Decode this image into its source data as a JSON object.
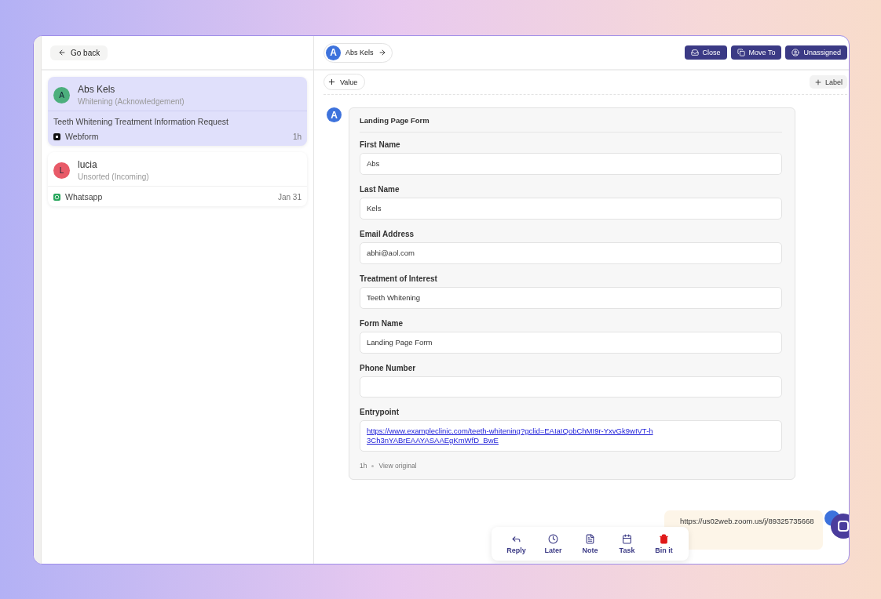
{
  "sidebar": {
    "back_button": "Go back",
    "conversations": [
      {
        "initial": "A",
        "name": "Abs Kels",
        "subtitle": "Whitening (Acknowledgement)",
        "subject": "Teeth Whitening Treatment Information Request",
        "channel": "Webform",
        "kind": "webform",
        "time": "1h",
        "selected": true,
        "color": "#4caf7d"
      },
      {
        "initial": "L",
        "name": "lucia",
        "subtitle": "Unsorted (Incoming)",
        "channel": "Whatsapp",
        "kind": "whatsapp",
        "time": "Jan 31",
        "selected": false,
        "color": "#e85a68"
      }
    ]
  },
  "header": {
    "contact_initial": "A",
    "contact_name": "Abs Kels",
    "buttons": [
      {
        "label": "Close",
        "kind": "close"
      },
      {
        "label": "Move To",
        "kind": "move"
      },
      {
        "label": "Unassigned",
        "kind": "user"
      }
    ]
  },
  "label_bar": {
    "value_button": "Value",
    "label_button": "Label"
  },
  "message": {
    "initial": "A",
    "title": "Landing Page Form",
    "fields": [
      {
        "label": "First Name",
        "value": "Abs"
      },
      {
        "label": "Last Name",
        "value": "Kels"
      },
      {
        "label": "Email Address",
        "value": "abhi@aol.com"
      },
      {
        "label": "Treatment of Interest",
        "value": "Teeth Whitening"
      },
      {
        "label": "Form Name",
        "value": "Landing Page Form"
      },
      {
        "label": "Phone Number"
      },
      {
        "label": "Entrypoint",
        "value": "https://www.exampleclinic.com/teeth-whitening?gclid=EAIaIQobChMI9r-YxvGk9wIVT-h3Ch3nYABrEAAYASAAEgKmWfD_BwE",
        "kind": "link"
      }
    ],
    "time": "1h",
    "view_original": "View original"
  },
  "reply_bubble": {
    "text": "https://us02web.zoom.us/j/89325735668"
  },
  "actions": [
    {
      "label": "Reply",
      "kind": "reply"
    },
    {
      "label": "Later",
      "kind": "later"
    },
    {
      "label": "Note",
      "kind": "note"
    },
    {
      "label": "Task",
      "kind": "task"
    },
    {
      "label": "Bin it",
      "kind": "bin"
    }
  ]
}
